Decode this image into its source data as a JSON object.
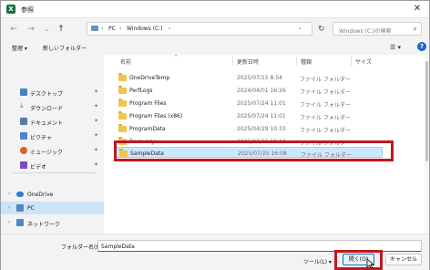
{
  "window": {
    "title": "参照",
    "app_icon_letter": "X"
  },
  "nav": {
    "back_glyph": "←",
    "forward_glyph": "→",
    "up_glyph": "↑",
    "refresh_glyph": "↻",
    "breadcrumbs": [
      "PC",
      "Windows (C:)"
    ],
    "search_placeholder": "Windows (C:)の検索"
  },
  "toolbar": {
    "organize_label": "整理 ▾",
    "new_folder_label": "新しいフォルダー"
  },
  "sidebar": {
    "quick_access": [
      {
        "label": "デスクトップ",
        "icon": "desktop-icon",
        "color": "#4a7fc1"
      },
      {
        "label": "ダウンロード",
        "icon": "download-icon",
        "color": "#2f7fd6"
      },
      {
        "label": "ドキュメント",
        "icon": "documents-icon",
        "color": "#5d7aa6"
      },
      {
        "label": "ピクチャ",
        "icon": "pictures-icon",
        "color": "#4a87c8"
      },
      {
        "label": "ミュージック",
        "icon": "music-icon",
        "color": "#e25f2b"
      },
      {
        "label": "ビデオ",
        "icon": "videos-icon",
        "color": "#7a4bc4"
      }
    ],
    "tree": [
      {
        "label": "OneDrive",
        "icon": "onedrive-icon",
        "color": "#2d7ad6"
      },
      {
        "label": "PC",
        "icon": "pc-icon",
        "color": "#4f86c6"
      },
      {
        "label": "ネットワーク",
        "icon": "network-icon",
        "color": "#4f86c6"
      }
    ]
  },
  "file_list": {
    "columns": [
      "名前",
      "更新日時",
      "種類",
      "サイズ"
    ],
    "rows": [
      {
        "name": "OneDriveTemp",
        "date": "2025/07/15 8:54",
        "type": "ファイル フォルダー"
      },
      {
        "name": "PerfLogs",
        "date": "2024/04/01 16:26",
        "type": "ファイル フォルダー"
      },
      {
        "name": "Program Files",
        "date": "2025/07/24 11:01",
        "type": "ファイル フォルダー"
      },
      {
        "name": "Program Files (x86)",
        "date": "2025/07/24 11:01",
        "type": "ファイル フォルダー"
      },
      {
        "name": "ProgramData",
        "date": "2025/04/29 10:33",
        "type": "ファイル フォルダー"
      },
      {
        "name": "Recovery",
        "date": "2025/07/11 19:24",
        "type": "ファイル フォルダー"
      },
      {
        "name": "SampleData",
        "date": "2025/07/25 16:08",
        "type": "ファイル フォルダー"
      }
    ]
  },
  "footer": {
    "folder_name_label": "フォルダー名(N):",
    "folder_name_value": "SampleData",
    "tools_label": "ツール(L) ▾",
    "open_label": "開く(O)",
    "cancel_label": "キャンセル"
  },
  "colors": {
    "highlight_red": "#c0181d",
    "selection_blue": "#cce8ff"
  }
}
